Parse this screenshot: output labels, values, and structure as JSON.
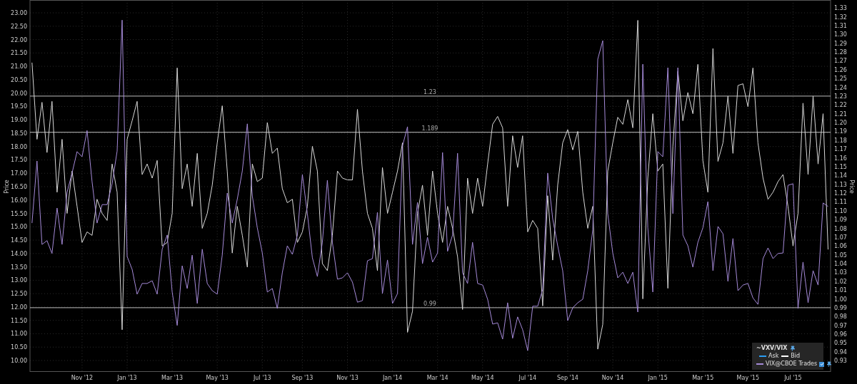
{
  "chart": {
    "chart_data": {
      "type": "line",
      "ylabel": "Price",
      "y2label": "Price",
      "grid": true,
      "ylim": [
        9.6,
        23.48
      ],
      "y2lim": [
        0.918,
        1.339
      ],
      "y2ticks": [
        {
          "value": 1.33,
          "label": "1.33"
        },
        {
          "value": 1.32,
          "label": "1.32"
        },
        {
          "value": 1.31,
          "label": "1.31"
        },
        {
          "value": 1.3,
          "label": "1.30"
        },
        {
          "value": 1.29,
          "label": "1.29"
        },
        {
          "value": 1.28,
          "label": "1.28"
        },
        {
          "value": 1.27,
          "label": "1.27"
        },
        {
          "value": 1.26,
          "label": "1.26"
        },
        {
          "value": 1.25,
          "label": "1.25"
        },
        {
          "value": 1.24,
          "label": "1.24"
        },
        {
          "value": 1.23,
          "label": "1.23"
        },
        {
          "value": 1.22,
          "label": "1.22"
        },
        {
          "value": 1.21,
          "label": "1.21"
        },
        {
          "value": 1.2,
          "label": "1.20"
        },
        {
          "value": 1.19,
          "label": "1.19"
        },
        {
          "value": 1.18,
          "label": "1.18"
        },
        {
          "value": 1.17,
          "label": "1.17"
        },
        {
          "value": 1.16,
          "label": "1.16"
        },
        {
          "value": 1.15,
          "label": "1.15"
        },
        {
          "value": 1.14,
          "label": "1.14"
        },
        {
          "value": 1.13,
          "label": "1.13"
        },
        {
          "value": 1.12,
          "label": "1.12"
        },
        {
          "value": 1.11,
          "label": "1.11"
        },
        {
          "value": 1.1,
          "label": "1.10"
        },
        {
          "value": 1.09,
          "label": "1.09"
        },
        {
          "value": 1.08,
          "label": "1.08"
        },
        {
          "value": 1.07,
          "label": "1.07"
        },
        {
          "value": 1.06,
          "label": "1.06"
        },
        {
          "value": 1.05,
          "label": "1.05"
        },
        {
          "value": 1.04,
          "label": "1.04"
        },
        {
          "value": 1.03,
          "label": "1.03"
        },
        {
          "value": 1.02,
          "label": "1.02"
        },
        {
          "value": 1.01,
          "label": "1.01"
        },
        {
          "value": 1.0,
          "label": "1.00"
        },
        {
          "value": 0.99,
          "label": "0.99"
        },
        {
          "value": 0.98,
          "label": "0.98"
        },
        {
          "value": 0.97,
          "label": "0.97"
        },
        {
          "value": 0.96,
          "label": "0.96"
        },
        {
          "value": 0.95,
          "label": "0.95"
        },
        {
          "value": 0.94,
          "label": "0.94"
        },
        {
          "value": 0.93,
          "label": "0.93"
        }
      ],
      "categories": [
        null,
        null,
        null,
        null,
        null,
        null,
        null,
        null,
        null,
        null,
        "Nov '12",
        null,
        null,
        null,
        null,
        null,
        null,
        null,
        null,
        "Jan '13",
        null,
        null,
        null,
        null,
        null,
        null,
        null,
        null,
        "Mar '13",
        null,
        null,
        null,
        null,
        null,
        null,
        null,
        null,
        "May '13",
        null,
        null,
        null,
        null,
        null,
        null,
        null,
        null,
        "Jul '13",
        null,
        null,
        null,
        null,
        null,
        null,
        null,
        "Sep '13",
        null,
        null,
        null,
        null,
        null,
        null,
        null,
        null,
        "Nov '13",
        null,
        null,
        null,
        null,
        null,
        null,
        null,
        null,
        "Jan '14",
        null,
        null,
        null,
        null,
        null,
        null,
        null,
        null,
        "Mar '14",
        null,
        null,
        null,
        null,
        null,
        null,
        null,
        null,
        "May '14",
        null,
        null,
        null,
        null,
        null,
        null,
        null,
        null,
        "Jul '14",
        null,
        null,
        null,
        null,
        null,
        null,
        null,
        "Sep '14",
        null,
        null,
        null,
        null,
        null,
        null,
        null,
        null,
        "Nov '14",
        null,
        null,
        null,
        null,
        null,
        null,
        null,
        null,
        "Jan '15",
        null,
        null,
        null,
        null,
        null,
        null,
        null,
        null,
        "Mar '15",
        null,
        null,
        null,
        null,
        null,
        null,
        null,
        null,
        "May '15",
        null,
        null,
        null,
        null,
        null,
        null,
        null,
        null,
        "Jul '15",
        null,
        null,
        null,
        null,
        null,
        null,
        null
      ],
      "yticks": [
        {
          "value": 10,
          "label": "10.00"
        },
        {
          "value": 10.5,
          "label": "10.50"
        },
        {
          "value": 11,
          "label": "11.00"
        },
        {
          "value": 11.5,
          "label": "11.50"
        },
        {
          "value": 12,
          "label": "12.00"
        },
        {
          "value": 12.5,
          "label": "12.50"
        },
        {
          "value": 13,
          "label": "13.00"
        },
        {
          "value": 13.5,
          "label": "13.50"
        },
        {
          "value": 14,
          "label": "14.00"
        },
        {
          "value": 14.5,
          "label": "14.50"
        },
        {
          "value": 15,
          "label": "15.00"
        },
        {
          "value": 15.5,
          "label": "15.50"
        },
        {
          "value": 16,
          "label": "16.00"
        },
        {
          "value": 16.5,
          "label": "16.50"
        },
        {
          "value": 17,
          "label": "17.00"
        },
        {
          "value": 17.5,
          "label": "17.50"
        },
        {
          "value": 18,
          "label": "18.00"
        },
        {
          "value": 18.5,
          "label": "18.50"
        },
        {
          "value": 19,
          "label": "19.00"
        },
        {
          "value": 19.5,
          "label": "19.50"
        },
        {
          "value": 20,
          "label": "20.00"
        },
        {
          "value": 20.5,
          "label": "20.50"
        },
        {
          "value": 21,
          "label": "21.00"
        },
        {
          "value": 21.5,
          "label": "21.50"
        },
        {
          "value": 22,
          "label": "22.00"
        },
        {
          "value": 22.5,
          "label": "22.50"
        },
        {
          "value": 23,
          "label": "23.00"
        }
      ],
      "series": [
        {
          "name": "~VXV/VIX",
          "axis": "y2",
          "color": "#d8d8d8",
          "values": [
            1.268,
            1.181,
            1.223,
            1.166,
            1.224,
            1.121,
            1.181,
            1.097,
            1.145,
            1.105,
            1.064,
            1.076,
            1.072,
            1.113,
            1.097,
            1.089,
            1.153,
            1.121,
            0.965,
            1.181,
            1.202,
            1.224,
            1.141,
            1.153,
            1.137,
            1.157,
            1.06,
            1.064,
            1.097,
            1.262,
            1.125,
            1.153,
            1.105,
            1.165,
            1.08,
            1.097,
            1.129,
            1.177,
            1.219,
            1.145,
            1.052,
            1.105,
            1.072,
            1.036,
            1.153,
            1.133,
            1.137,
            1.2,
            1.165,
            1.171,
            1.125,
            1.109,
            1.113,
            1.064,
            1.076,
            1.105,
            1.173,
            1.145,
            1.04,
            1.032,
            1.072,
            1.145,
            1.137,
            1.135,
            1.135,
            1.215,
            1.145,
            1.097,
            1.08,
            1.032,
            1.149,
            1.097,
            1.121,
            1.145,
            1.177,
            0.962,
            0.986,
            1.097,
            1.129,
            1.072,
            1.145,
            1.097,
            1.064,
            1.105,
            1.08,
            1.048,
            0.988,
            1.137,
            1.097,
            1.137,
            1.105,
            1.153,
            1.198,
            1.207,
            1.194,
            1.105,
            1.185,
            1.149,
            1.185,
            1.076,
            1.089,
            1.08,
            0.992,
            1.117,
            1.044,
            1.129,
            1.177,
            1.192,
            1.169,
            1.19,
            1.121,
            1.08,
            1.105,
            0.943,
            0.971,
            1.145,
            1.177,
            1.206,
            1.198,
            1.226,
            1.194,
            1.316,
            1.0,
            1.137,
            1.21,
            1.145,
            1.153,
            1.012,
            1.173,
            1.258,
            1.202,
            1.234,
            1.21,
            1.266,
            1.157,
            1.121,
            1.284,
            1.156,
            1.177,
            1.23,
            1.165,
            1.242,
            1.244,
            1.218,
            1.262,
            1.177,
            1.137,
            1.113,
            1.121,
            1.133,
            1.141,
            1.105,
            1.06,
            1.097,
            1.222,
            1.141,
            1.23,
            1.153,
            1.21,
            1.056
          ]
        },
        {
          "name": "VIX@CBOE Trades",
          "color": "#a58ad8",
          "values": [
            15.14,
            17.46,
            14.34,
            14.48,
            14.0,
            15.7,
            14.34,
            16.29,
            17.01,
            17.81,
            17.62,
            18.6,
            16.69,
            15.14,
            15.83,
            15.83,
            16.61,
            17.83,
            22.73,
            13.89,
            13.41,
            12.48,
            12.88,
            12.88,
            12.98,
            12.48,
            14.16,
            14.69,
            12.56,
            11.31,
            13.54,
            12.69,
            13.94,
            12.13,
            14.16,
            12.88,
            12.61,
            12.48,
            13.94,
            16.26,
            15.14,
            16.02,
            17.09,
            18.85,
            16.15,
            14.96,
            14.02,
            12.56,
            12.69,
            11.95,
            13.28,
            14.29,
            13.97,
            14.69,
            16.95,
            15.49,
            13.84,
            13.14,
            14.42,
            16.74,
            14.42,
            13.04,
            13.09,
            13.28,
            12.93,
            12.18,
            12.24,
            13.73,
            13.81,
            15.54,
            12.5,
            13.76,
            12.13,
            12.5,
            18.02,
            18.74,
            14.34,
            15.91,
            13.62,
            14.61,
            13.68,
            14.02,
            17.78,
            14.08,
            14.69,
            17.75,
            13.28,
            12.88,
            14.42,
            12.88,
            12.82,
            12.29,
            11.36,
            11.41,
            10.8,
            12.16,
            10.83,
            11.63,
            11.15,
            10.37,
            12.03,
            12.03,
            12.66,
            17.01,
            15.3,
            14.29,
            13.36,
            11.49,
            11.97,
            12.16,
            12.29,
            13.36,
            14.88,
            21.27,
            21.96,
            15.49,
            14.02,
            13.09,
            13.3,
            12.88,
            13.3,
            11.81,
            21.08,
            14.96,
            12.56,
            17.81,
            17.62,
            20.95,
            15.49,
            20.95,
            14.69,
            14.29,
            13.49,
            14.42,
            14.96,
            15.94,
            13.36,
            15.01,
            14.74,
            12.96,
            14.56,
            12.61,
            12.82,
            12.88,
            12.34,
            12.1,
            13.81,
            14.21,
            13.81,
            14.0,
            14.02,
            16.55,
            16.61,
            11.95,
            13.68,
            12.16,
            13.36,
            12.82,
            15.89,
            15.76
          ]
        }
      ]
    },
    "reference_lines": [
      {
        "label": "1.23"
      },
      {
        "label": "1.189"
      },
      {
        "label": "0.99"
      }
    ]
  },
  "legend": {
    "items": [
      {
        "label": "Ask",
        "color": "#2a9df4"
      },
      {
        "label": "Bid",
        "color": "#ffffff"
      }
    ],
    "trades": {
      "checked": true
    }
  }
}
